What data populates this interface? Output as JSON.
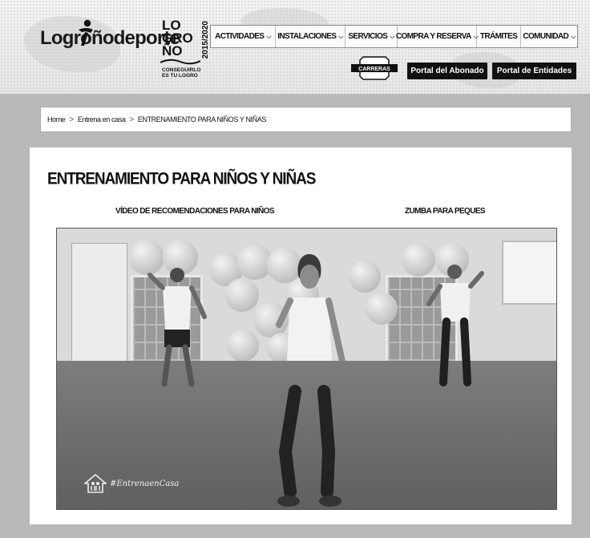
{
  "header": {
    "logo_text": "Logroñodeporte",
    "badge": {
      "line1": "LO",
      "line2": "GRO",
      "line3": "ÑO",
      "years": "2015/2020",
      "slogan_line1": "CONSEGUIRLO",
      "slogan_line2": "ES TU LOGRO"
    },
    "nav": [
      {
        "label": "ACTIVIDADES",
        "dropdown": true
      },
      {
        "label": "INSTALACIONES",
        "dropdown": true
      },
      {
        "label": "SERVICIOS",
        "dropdown": true
      },
      {
        "label": "COMPRA Y RESERVA",
        "dropdown": true
      },
      {
        "label": "TRÁMITES",
        "dropdown": false
      },
      {
        "label": "COMUNIDAD",
        "dropdown": true
      }
    ],
    "carreras_label": "CARRERAS",
    "portal_abonado": "Portal del Abonado",
    "portal_entidades": "Portal de Entidades"
  },
  "breadcrumb": {
    "items": [
      "Home",
      "Entrena en casa",
      "ENTRENAMIENTO PARA NIÑOS Y NIÑAS"
    ],
    "separator": ">"
  },
  "main": {
    "title": "ENTRENAMIENTO PARA NIÑOS Y NIÑAS",
    "video_labels": {
      "left": "VÍDEO DE RECOMENDACIONES PARA NIÑOS",
      "right": "ZUMBA PARA PEQUES"
    },
    "video": {
      "watermark": "#EntrenaenCasa"
    }
  },
  "colors": {
    "header_bg": "#eeeeee",
    "page_bg": "#b9b9b9",
    "card_bg": "#ffffff",
    "button_dark": "#111111"
  }
}
